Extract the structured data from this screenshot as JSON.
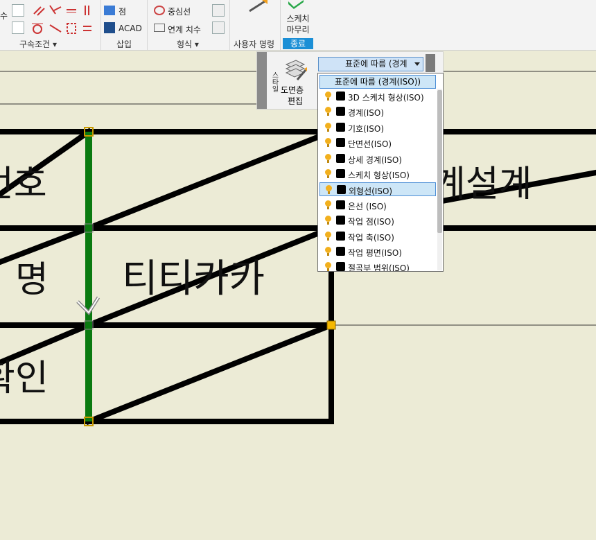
{
  "ribbon": {
    "partial_left_label": "수",
    "constraints_group": "구속조건",
    "insert_group": "삽입",
    "format_group": "형식",
    "user_commands_group": "사용자 명령",
    "finish_group": "종료",
    "point_label": "점",
    "acad_label": "ACAD",
    "centerline_label": "중심선",
    "linked_dim_label": "연계 치수",
    "finish_sketch_line1": "스케치",
    "finish_sketch_line2": "마무리"
  },
  "float_toolbar": {
    "vertical_label": "스타일",
    "edit_layer_line1": "도면층",
    "edit_layer_line2": "편집",
    "combo_value": "표준에 따름 (경계"
  },
  "dropdown": {
    "header": "표준에 따름 (경계(ISO))",
    "items": [
      {
        "label": "3D 스케치 형상(ISO)"
      },
      {
        "label": "경계(ISO)"
      },
      {
        "label": "기호(ISO)"
      },
      {
        "label": "단면선(ISO)"
      },
      {
        "label": "상세 경계(ISO)"
      },
      {
        "label": "스케치 형상(ISO)"
      },
      {
        "label": "외형선(ISO)",
        "highlighted": true
      },
      {
        "label": "은선 (ISO)"
      },
      {
        "label": "작업 점(ISO)"
      },
      {
        "label": "작업 축(ISO)"
      },
      {
        "label": "작업 평면(ISO)"
      },
      {
        "label": "절곡부 범위(ISO)"
      }
    ]
  },
  "drawing": {
    "text_row1": "번호",
    "text_row2_left": "명",
    "text_row2_mid": "티티카카",
    "text_row3": "확인",
    "text_right": "계설계"
  },
  "colors": {
    "accent": "#1b8fd6",
    "canvas_bg": "#ecebd6",
    "selected_line": "#0a7a10",
    "handle": "#f5b800"
  }
}
